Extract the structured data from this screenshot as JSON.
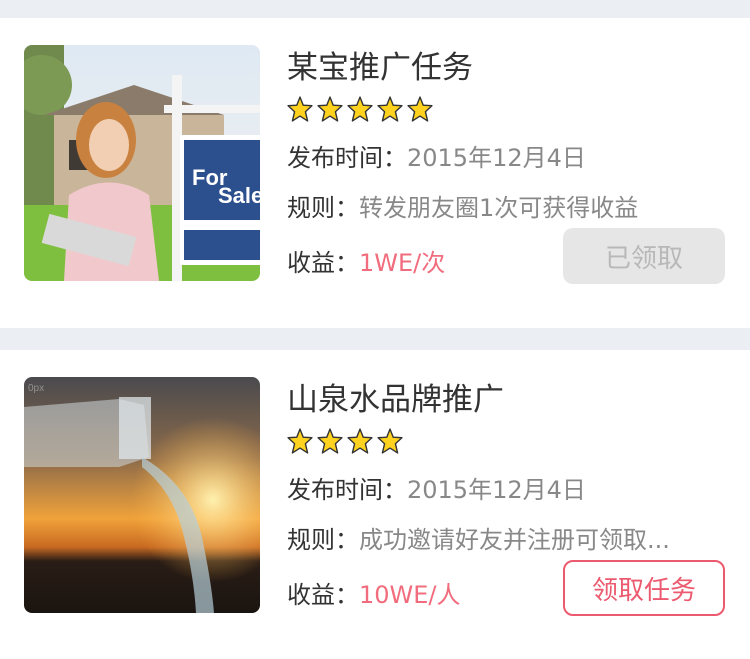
{
  "tasks": [
    {
      "title": "某宝推广任务",
      "stars": 5,
      "time_label": "发布时间：",
      "time_value": "2015年12月4日",
      "rule_label": "规则：",
      "rule_value": "转发朋友圈1次可获得收益",
      "earn_label": "收益：",
      "earn_value": "1WE/次",
      "button_label": "已领取",
      "button_state": "disabled",
      "image_desc": "woman-house-for-sale"
    },
    {
      "title": "山泉水品牌推广",
      "stars": 4,
      "time_label": "发布时间：",
      "time_value": "2015年12月4日",
      "rule_label": "规则：",
      "rule_value": "成功邀请好友并注册可领取...",
      "earn_label": "收益：",
      "earn_value": "10WE/人",
      "button_label": "领取任务",
      "button_state": "active",
      "image_desc": "water-bottle-sunset"
    }
  ],
  "colors": {
    "accent": "#ec5a6f",
    "earn_text": "#f16c7d",
    "star": "#ffd21f",
    "background": "#ebeef2"
  }
}
